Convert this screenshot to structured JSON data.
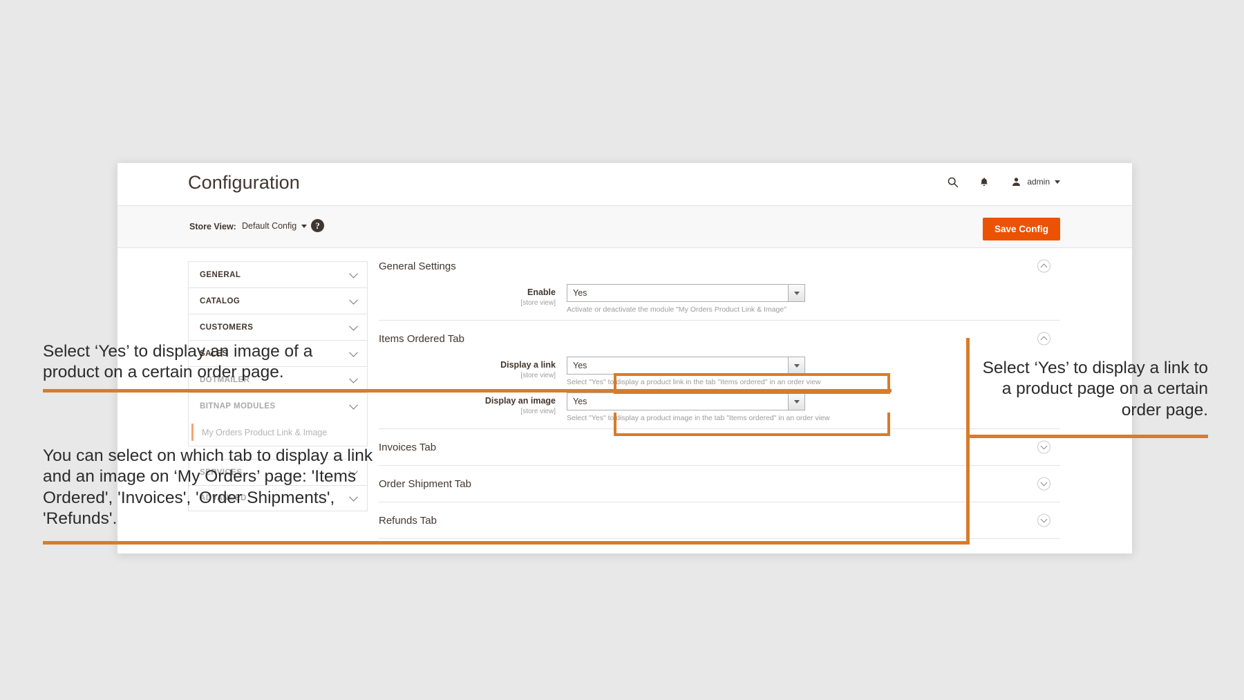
{
  "header": {
    "page_title": "Configuration",
    "search_icon": "search-icon",
    "notifications_icon": "bell-icon",
    "account_icon": "user-icon",
    "account_label": "admin"
  },
  "storeview_bar": {
    "label": "Store View:",
    "selected": "Default Config",
    "help_glyph": "?",
    "save_button": "Save Config",
    "save_button_color": "#eb5202"
  },
  "sidebar": {
    "sections": [
      {
        "label": "GENERAL",
        "dim": false
      },
      {
        "label": "CATALOG",
        "dim": false
      },
      {
        "label": "CUSTOMERS",
        "dim": false
      },
      {
        "label": "SALES",
        "dim": false
      },
      {
        "label": "DOTMAILER",
        "dim": true
      },
      {
        "label": "BITNAP MODULES",
        "dim": true
      }
    ],
    "subitems": [
      {
        "label": "My Orders Product Link & Image",
        "active": true
      }
    ],
    "sections_bottom": [
      {
        "label": "SERVICES",
        "dim": true
      },
      {
        "label": "ADVANCED",
        "dim": true
      }
    ]
  },
  "main": {
    "sections": [
      {
        "title": "General Settings",
        "toggle": "chevron-up-icon",
        "expanded": true,
        "fields": [
          {
            "label": "Enable",
            "scope": "[store view]",
            "value": "Yes",
            "note": "Activate or deactivate the module \"My Orders Product Link & Image\""
          }
        ]
      },
      {
        "title": "Items Ordered Tab",
        "toggle": "chevron-up-icon",
        "expanded": true,
        "fields": [
          {
            "label": "Display a link",
            "scope": "[store view]",
            "value": "Yes",
            "note": "Select \"Yes\" to display a product link in the tab \"Items ordered\" in an order view"
          },
          {
            "label": "Display an image",
            "scope": "[store view]",
            "value": "Yes",
            "note": "Select \"Yes\" to display a product image in the tab \"Items ordered\" in an order view"
          }
        ]
      },
      {
        "title": "Invoices Tab",
        "toggle": "chevron-down-icon",
        "expanded": false,
        "fields": []
      },
      {
        "title": "Order Shipment Tab",
        "toggle": "chevron-down-icon",
        "expanded": false,
        "fields": []
      },
      {
        "title": "Refunds Tab",
        "toggle": "chevron-down-icon",
        "expanded": false,
        "fields": []
      }
    ]
  },
  "annotations": {
    "accent_color": "#d97b29",
    "left_top": "Select ‘Yes’ to display an image of a product on a certain order page.",
    "left_bottom": "You can select on which tab to display a link and an image on ‘My Orders’ page: 'Items Ordered', 'Invoices', 'Order Shipments', 'Refunds'.",
    "right": "Select ‘Yes’ to display a link to a product page on a certain order page."
  }
}
